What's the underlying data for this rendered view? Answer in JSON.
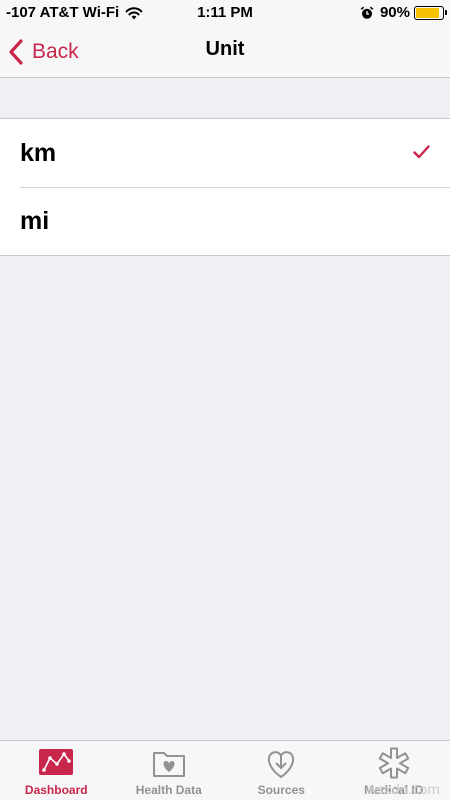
{
  "status_bar": {
    "carrier": "-107 AT&T Wi-Fi",
    "time": "1:11 PM",
    "battery_percent": "90%",
    "battery_level": 0.9,
    "battery_color": "#f5c100"
  },
  "nav": {
    "back_label": "Back",
    "title": "Unit",
    "accent_color": "#c8264a"
  },
  "options": [
    {
      "label": "km",
      "selected": true
    },
    {
      "label": "mi",
      "selected": false
    }
  ],
  "tabs": [
    {
      "label": "Dashboard",
      "icon": "dashboard-icon",
      "active": true
    },
    {
      "label": "Health Data",
      "icon": "health-data-icon",
      "active": false
    },
    {
      "label": "Sources",
      "icon": "sources-icon",
      "active": false
    },
    {
      "label": "Medical ID",
      "icon": "medical-id-icon",
      "active": false
    }
  ],
  "watermark": "wsxdn.com"
}
